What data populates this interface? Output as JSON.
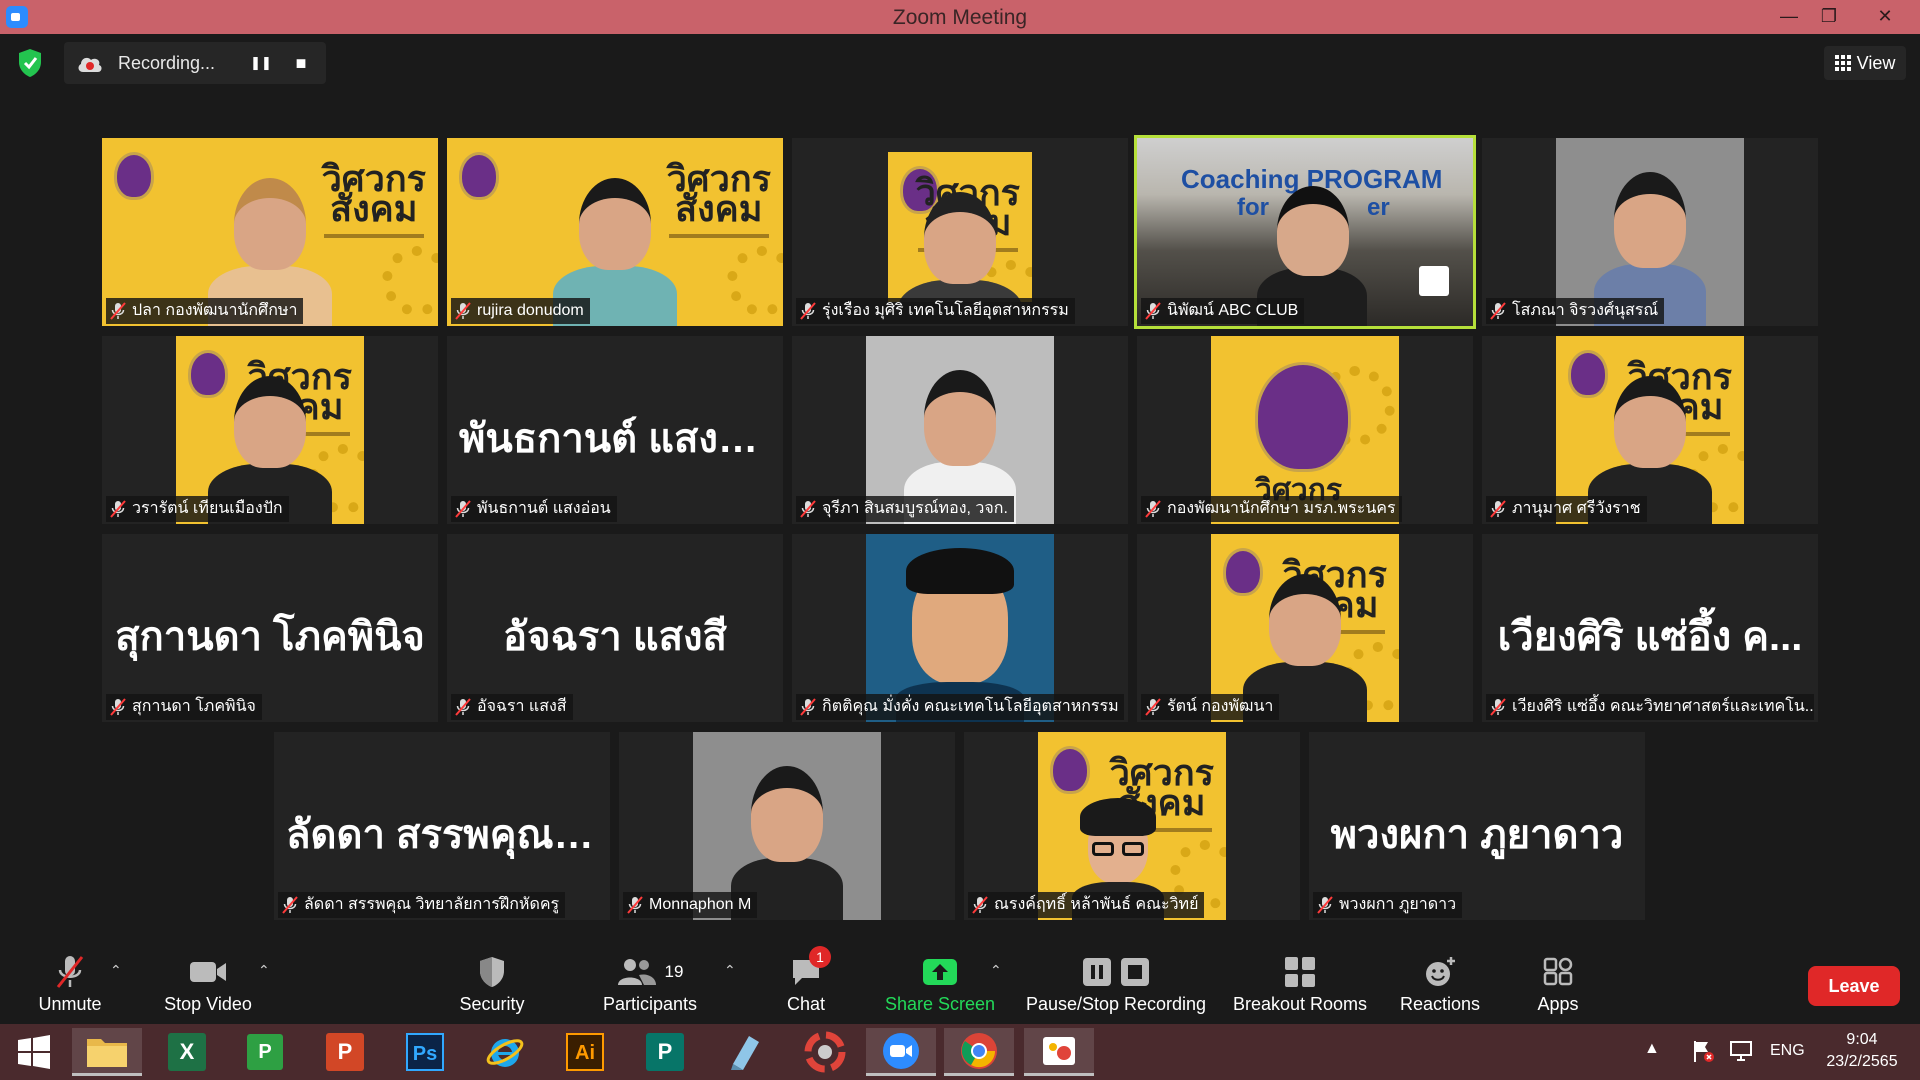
{
  "window": {
    "title": "Zoom Meeting",
    "minimize": "—",
    "restore": "❐",
    "close": "✕"
  },
  "recording": {
    "status": "Recording...",
    "pause_glyph": "❚❚",
    "stop_glyph": "■"
  },
  "view_button": {
    "label": "View"
  },
  "participants_grid": [
    {
      "label": "ปลา กองพัฒนานักศึกษา",
      "kind": "poster-person"
    },
    {
      "label": "rujira donudom",
      "kind": "poster-person"
    },
    {
      "label": "รุ่งเรือง มุศิริ เทคโนโลยีอุตสาหกรรม",
      "kind": "poster-small"
    },
    {
      "label": "นิพัฒน์ ABC CLUB",
      "kind": "coaching",
      "active": true,
      "screen_text": "Coaching PROGRAM",
      "screen_text2": "for",
      "screen_text3": "er"
    },
    {
      "label": "โสภณา จิรวงศ์นุสรณ์",
      "kind": "photo"
    },
    {
      "label": "วรารัตน์ เทียนเมืองปัก",
      "kind": "poster-person"
    },
    {
      "label": "พันธกานต์ แสงอ่อน",
      "kind": "name",
      "big_name": "พันธกานต์ แสงอ่อน"
    },
    {
      "label": "จุรีภา สินสมบูรณ์ทอง, วจก.",
      "kind": "photo"
    },
    {
      "label": "กองพัฒนานักศึกษา มรภ.พระนคร",
      "kind": "poster-seal"
    },
    {
      "label": "ภานุมาศ ศรีวังราช",
      "kind": "poster-person"
    },
    {
      "label": "สุกานดา โภคพินิจ",
      "kind": "name",
      "big_name": "สุกานดา โภคพินิจ"
    },
    {
      "label": "อัจฉรา แสงสี",
      "kind": "name",
      "big_name": "อัจฉรา แสงสี"
    },
    {
      "label": "กิตติคุณ มั่งคั่ง คณะเทคโนโลยีอุตสาหกรรม",
      "kind": "cartoon"
    },
    {
      "label": "รัตน์ กองพัฒนา",
      "kind": "poster-person"
    },
    {
      "label": "เวียงศิริ แซ่อึ้ง คณะวิทยาศาสตร์และเทคโน...",
      "kind": "name",
      "big_name": "เวียงศิริ แซ่อึ้ง ค..."
    },
    {
      "label": "ลัดดา สรรพคุณ วิทยาลัยการฝึกหัดครู",
      "kind": "name",
      "big_name": "ลัดดา สรรพคุณ วิ..."
    },
    {
      "label": "Monnaphon M",
      "kind": "photo"
    },
    {
      "label": "ณรงค์ฤทธิ์ หล้าพันธ์ คณะวิทย์",
      "kind": "poster-cartoon"
    },
    {
      "label": "พวงผกา ภูยาดาว",
      "kind": "name",
      "big_name": "พวงผกา ภูยาดาว"
    }
  ],
  "poster": {
    "title_line1": "วิศวกร",
    "title_line2": "สังคม"
  },
  "toolbar": {
    "unmute": "Unmute",
    "stop_video": "Stop Video",
    "security": "Security",
    "participants": "Participants",
    "participants_count": "19",
    "chat": "Chat",
    "chat_badge": "1",
    "share_screen": "Share Screen",
    "pause_stop_recording": "Pause/Stop Recording",
    "breakout_rooms": "Breakout Rooms",
    "reactions": "Reactions",
    "apps": "Apps",
    "leave": "Leave"
  },
  "taskbar": {
    "apps": [
      "file-explorer",
      "excel",
      "publisher-green",
      "powerpoint",
      "photoshop",
      "internet-explorer",
      "illustrator",
      "publisher",
      "notepad",
      "photoscape",
      "zoom",
      "chrome",
      "paint"
    ],
    "labels": {
      "excel": "X",
      "publisher_green": "P",
      "powerpoint": "P",
      "photoshop": "Ps",
      "illustrator": "Ai",
      "publisher": "P"
    },
    "language": "ENG",
    "time": "9:04",
    "date": "23/2/2565"
  },
  "colors": {
    "titlebar": "#c9626a",
    "active_border": "#b6e03a",
    "leave": "#e02828",
    "share": "#23d959",
    "taskbar": "#4a2a2d"
  }
}
